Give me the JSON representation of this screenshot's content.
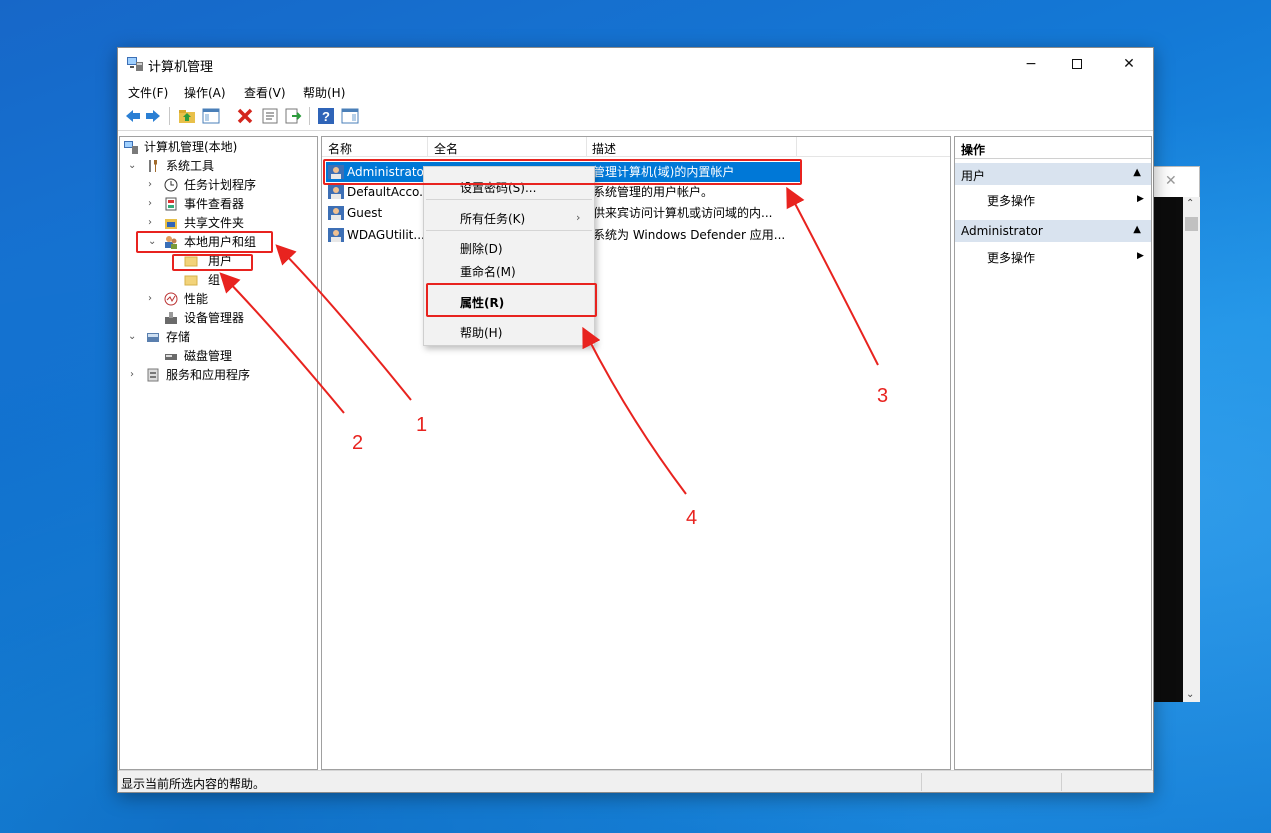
{
  "window": {
    "title": "计算机管理",
    "controls": {
      "minimize": "−",
      "close": "✕"
    }
  },
  "menubar": {
    "items": [
      "文件(F)",
      "操作(A)",
      "查看(V)",
      "帮助(H)"
    ]
  },
  "tree": {
    "root": "计算机管理(本地)",
    "system_tools": "系统工具",
    "task_scheduler": "任务计划程序",
    "event_viewer": "事件查看器",
    "shared_folders": "共享文件夹",
    "local_users_groups": "本地用户和组",
    "users": "用户",
    "groups": "组",
    "performance": "性能",
    "device_manager": "设备管理器",
    "storage": "存储",
    "disk_management": "磁盘管理",
    "services_apps": "服务和应用程序"
  },
  "list": {
    "headers": {
      "name": "名称",
      "fullname": "全名",
      "description": "描述"
    },
    "rows": [
      {
        "name": "Administrator",
        "description": "管理计算机(域)的内置帐户"
      },
      {
        "name": "DefaultAcco...",
        "description": "系统管理的用户帐户。"
      },
      {
        "name": "Guest",
        "description": "供来宾访问计算机或访问域的内..."
      },
      {
        "name": "WDAGUtilit...",
        "description": "系统为 Windows Defender 应用..."
      }
    ]
  },
  "context_menu": {
    "set_password": "设置密码(S)...",
    "all_tasks": "所有任务(K)",
    "delete": "删除(D)",
    "rename": "重命名(M)",
    "properties": "属性(R)",
    "help": "帮助(H)"
  },
  "actions": {
    "header": "操作",
    "section1": "用户",
    "section1_more": "更多操作",
    "section2": "Administrator",
    "section2_more": "更多操作"
  },
  "status": {
    "text": "显示当前所选内容的帮助。"
  },
  "annotations": {
    "labels": [
      "1",
      "2",
      "3",
      "4"
    ],
    "color": "#e8231f"
  },
  "colors": {
    "selection": "#0078d7",
    "action_section": "#d9e3ef",
    "desktop": "#1479d6"
  }
}
